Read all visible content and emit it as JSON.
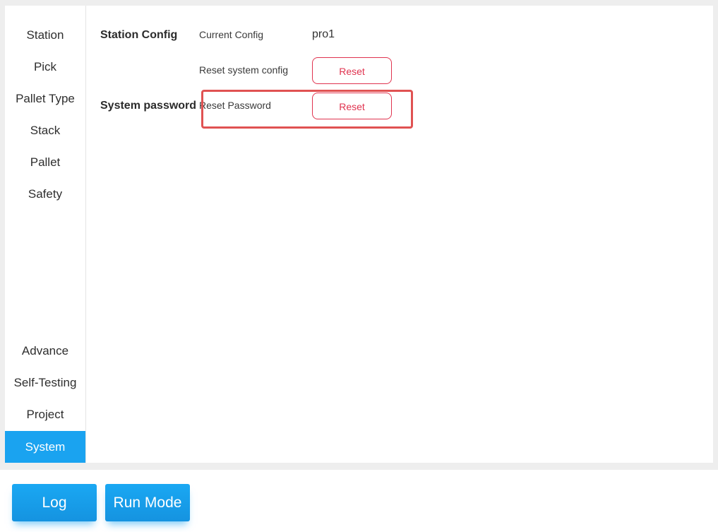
{
  "sidebar": {
    "items": [
      {
        "label": "Station"
      },
      {
        "label": "Pick"
      },
      {
        "label": "Pallet Type"
      },
      {
        "label": "Stack"
      },
      {
        "label": "Pallet"
      },
      {
        "label": "Safety"
      },
      {
        "label": "Advance"
      },
      {
        "label": "Self-Testing"
      },
      {
        "label": "Project"
      },
      {
        "label": "System"
      }
    ],
    "active": "System"
  },
  "station_config": {
    "section_label": "Station Config",
    "current_config_label": "Current Config",
    "current_config_value": "pro1",
    "reset_system_config_label": "Reset system config",
    "reset_button_label": "Reset"
  },
  "system_password": {
    "section_label": "System password",
    "reset_password_label": "Reset Password",
    "reset_button_label": "Reset"
  },
  "bottom_bar": {
    "log_label": "Log",
    "run_mode_label": "Run Mode"
  },
  "colors": {
    "accent": "#1aa3f0",
    "danger": "#e0334f",
    "highlight": "#e05252"
  }
}
